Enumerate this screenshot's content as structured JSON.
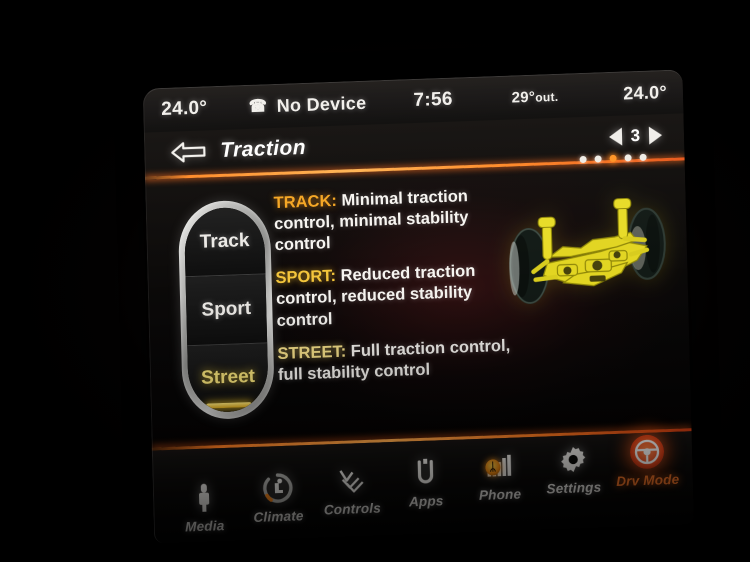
{
  "status_bar": {
    "left_temp": "24.0°",
    "device_icon": "bluetooth-phone-icon",
    "device_label": "No Device",
    "clock": "7:56",
    "outside_temp_value": "29°",
    "outside_temp_label": "out.",
    "right_temp": "24.0°"
  },
  "header": {
    "back_icon": "back-arrow-icon",
    "title": "Traction",
    "prev_icon": "chevron-left-icon",
    "page_number": "3",
    "next_icon": "chevron-right-icon",
    "total_pages": 5,
    "active_page_index": 2,
    "divider_color": "#ff8a28"
  },
  "mode_selector": {
    "name": "drive-mode-wheel",
    "options": [
      {
        "label": "Track",
        "selected": false
      },
      {
        "label": "Sport",
        "selected": false
      },
      {
        "label": "Street",
        "selected": true
      }
    ]
  },
  "descriptions": [
    {
      "key": "TRACK:",
      "key_class": "track",
      "text": " Minimal traction control, minimal stability control"
    },
    {
      "key": "SPORT:",
      "key_class": "sport",
      "text": " Reduced traction control, reduced stability control"
    },
    {
      "key": "STREET:",
      "key_class": "street",
      "text": " Full traction control, full stability control"
    }
  ],
  "illustration": {
    "name": "suspension-chassis-graphic",
    "chassis_color": "#e8dc28",
    "tire_color": "#1c2420"
  },
  "nav_bar": {
    "items": [
      {
        "label": "Media",
        "icon": "media-aux-icon",
        "active": false
      },
      {
        "label": "Climate",
        "icon": "climate-seat-icon",
        "active": false
      },
      {
        "label": "Controls",
        "icon": "controls-seat-icon",
        "active": false
      },
      {
        "label": "Apps",
        "icon": "apps-icon",
        "active": false
      },
      {
        "label": "Phone",
        "icon": "signal-bars-icon",
        "active": false,
        "badge": "bluetooth-icon",
        "badge_glyph": "ᛦ"
      },
      {
        "label": "Settings",
        "icon": "gear-icon",
        "active": false
      },
      {
        "label": "Drv Mode",
        "icon": "steering-wheel-icon",
        "active": true
      }
    ],
    "accent_color": "#ff7a2a"
  }
}
